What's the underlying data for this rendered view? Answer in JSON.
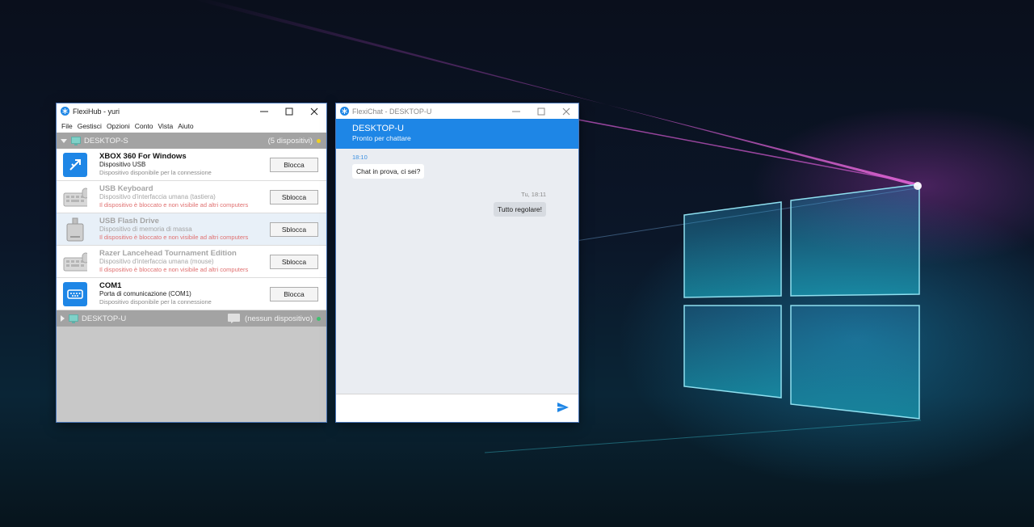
{
  "colors": {
    "accent": "#1e86e6",
    "group_header": "#a3a3a3",
    "status_yellow": "#f0d020",
    "status_green": "#40c070",
    "locked_text": "#e07070"
  },
  "flexihub": {
    "title": "FlexiHub - yuri",
    "menu": [
      "File",
      "Gestisci",
      "Opzioni",
      "Conto",
      "Vista",
      "Aiuto"
    ],
    "groups": [
      {
        "name": "DESKTOP-S",
        "count": "(5 dispositivi)",
        "expanded": true,
        "status_color": "#f0d020",
        "devices": [
          {
            "name": "XBOX 360 For Windows",
            "type": "Dispositivo USB",
            "status": "Dispositivo disponibile per la connessione",
            "button": "Blocca",
            "icon": "usb-icon",
            "locked": false
          },
          {
            "name": "USB Keyboard",
            "type": "Dispositivo d'interfaccia umana (tastiera)",
            "status": "Il dispositivo è bloccato e non visibile ad altri computers",
            "button": "Sblocca",
            "icon": "keyboard-icon",
            "locked": true
          },
          {
            "name": "USB Flash Drive",
            "type": "Dispositivo di memoria di massa",
            "status": "Il dispositivo è bloccato e non visibile ad altri computers",
            "button": "Sblocca",
            "icon": "flash-drive-icon",
            "locked": true
          },
          {
            "name": "Razer Lancehead Tournament Edition",
            "type": "Dispositivo d'interfaccia umana (mouse)",
            "status": "Il dispositivo è bloccato e non visibile ad altri computers",
            "button": "Sblocca",
            "icon": "keyboard-icon",
            "locked": true
          },
          {
            "name": "COM1",
            "type": "Porta di comunicazione (COM1)",
            "status": "Dispositivo disponibile per la connessione",
            "button": "Blocca",
            "icon": "serial-port-icon",
            "locked": false
          }
        ]
      },
      {
        "name": "DESKTOP-U",
        "count": "(nessun dispositivo)",
        "expanded": false,
        "status_color": "#40c070"
      }
    ]
  },
  "flexichat": {
    "title": "FlexiChat - DESKTOP-U",
    "peer": "DESKTOP-U",
    "peer_status": "Pronto per chattare",
    "messages": [
      {
        "time": "18:10",
        "text": "Chat in prova, ci sei?",
        "direction": "in"
      },
      {
        "time": "Tu, 18:11",
        "text": "Tutto regolare!",
        "direction": "out"
      }
    ],
    "input_placeholder": ""
  }
}
